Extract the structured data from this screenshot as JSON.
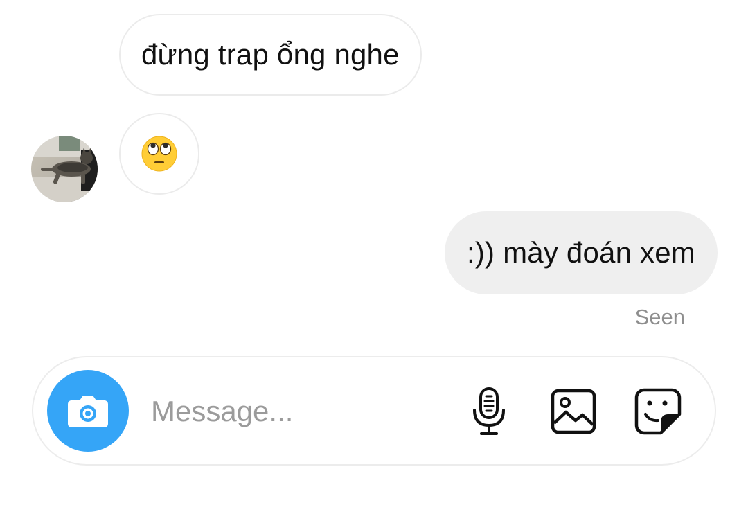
{
  "thread": {
    "messages": [
      {
        "direction": "incoming",
        "text": "đừng trap ổng nghe"
      },
      {
        "direction": "incoming",
        "type": "emoji",
        "emoji": "face-with-rolling-eyes"
      },
      {
        "direction": "outgoing",
        "text": ":)) mày đoán xem"
      }
    ],
    "seen_label": "Seen"
  },
  "composer": {
    "placeholder": "Message...",
    "icons": [
      "camera-icon",
      "microphone-icon",
      "gallery-icon",
      "sticker-icon"
    ]
  },
  "colors": {
    "camera_button": "#35a5f7",
    "outgoing_bubble": "#efefef",
    "incoming_bubble_border": "#ebebeb",
    "seen_text": "#8e8e8e"
  }
}
